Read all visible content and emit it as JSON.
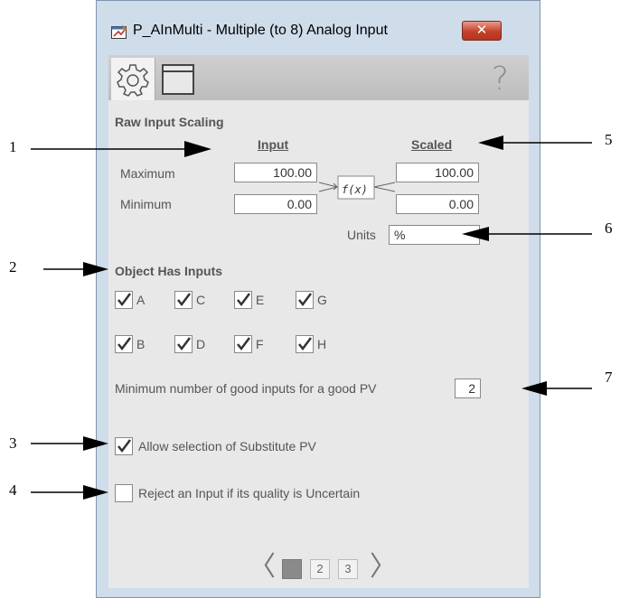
{
  "window": {
    "title": "P_AInMulti - Multiple (to 8) Analog Input",
    "close_label": "✕"
  },
  "toolbar": {
    "tabs": [
      "gear-icon",
      "window-icon"
    ],
    "help_label": "?"
  },
  "scaling": {
    "section_title": "Raw Input Scaling",
    "input_header": "Input",
    "scaled_header": "Scaled",
    "max_label": "Maximum",
    "min_label": "Minimum",
    "input_max": "100.00",
    "input_min": "0.00",
    "func_label": "f(x)",
    "scaled_max": "100.00",
    "scaled_min": "0.00",
    "units_label": "Units",
    "units_value": "%"
  },
  "inputs": {
    "section_title": "Object Has Inputs",
    "items": [
      {
        "label": "A",
        "checked": true
      },
      {
        "label": "C",
        "checked": true
      },
      {
        "label": "E",
        "checked": true
      },
      {
        "label": "G",
        "checked": true
      },
      {
        "label": "B",
        "checked": true
      },
      {
        "label": "D",
        "checked": true
      },
      {
        "label": "F",
        "checked": true
      },
      {
        "label": "H",
        "checked": true
      }
    ]
  },
  "min_good": {
    "label": "Minimum number of good inputs for a good PV",
    "value": "2"
  },
  "options": {
    "allow_substitute_label": "Allow selection of Substitute PV",
    "allow_substitute_checked": true,
    "reject_uncertain_label": "Reject an Input if its quality is Uncertain",
    "reject_uncertain_checked": false
  },
  "pager": {
    "prev": "〈",
    "next": "〉",
    "pages": [
      "1",
      "2",
      "3"
    ],
    "active_page": "1"
  },
  "callouts": [
    "1",
    "2",
    "3",
    "4",
    "5",
    "6",
    "7"
  ]
}
